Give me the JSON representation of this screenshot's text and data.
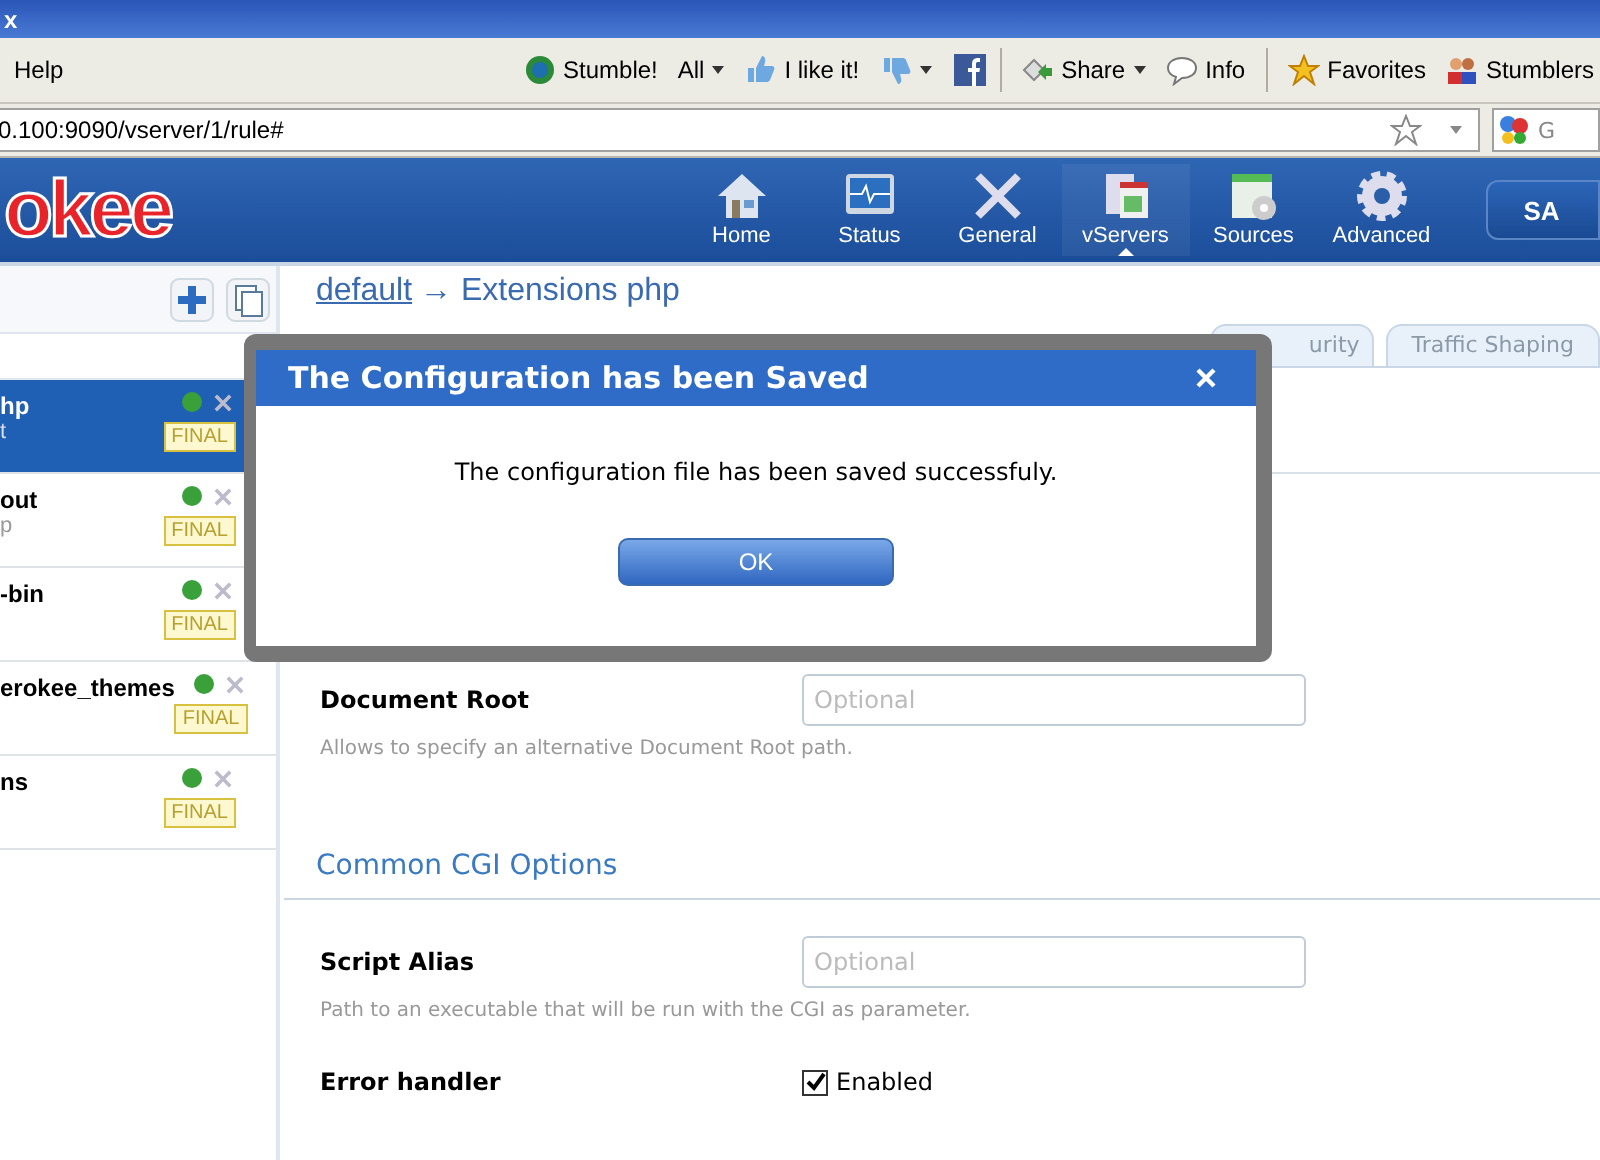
{
  "window": {
    "title": "x"
  },
  "menu": [
    {
      "label": "Help"
    }
  ],
  "toolbar": [
    {
      "label": "Stumble!",
      "dropdown": false
    },
    {
      "label": "All",
      "dropdown": true
    },
    {
      "label": "I like it!",
      "dropdown": false
    },
    {
      "dropdown": true
    },
    {
      "label": "Share",
      "dropdown": true
    },
    {
      "label": "Info",
      "dropdown": false
    },
    {
      "label": "Favorites",
      "dropdown": false
    },
    {
      "label": "Stumblers",
      "dropdown": false
    }
  ],
  "address": {
    "url": "0.100:9090/vserver/1/rule#",
    "search": "G"
  },
  "header": {
    "logo": "okee",
    "save": "SA"
  },
  "nav": [
    {
      "label": "Home",
      "selected": false
    },
    {
      "label": "Status",
      "selected": false
    },
    {
      "label": "General",
      "selected": false
    },
    {
      "label": "vServers",
      "selected": true
    },
    {
      "label": "Sources",
      "selected": false
    },
    {
      "label": "Advanced",
      "selected": false
    }
  ],
  "sidebar": {
    "items": [
      {
        "name": "hp",
        "sub": "t",
        "selected": true,
        "badge": "FINAL"
      },
      {
        "name": "out",
        "sub": "p",
        "selected": false,
        "badge": "FINAL"
      },
      {
        "name": "-bin",
        "selected": false,
        "badge": "FINAL"
      },
      {
        "name": "erokee_themes",
        "selected": false,
        "badge": "FINAL"
      },
      {
        "name": "ns",
        "selected": false,
        "badge": "FINAL"
      }
    ]
  },
  "breadcrumb": {
    "link": "default",
    "rest": "→ Extensions php"
  },
  "tabs": [
    {
      "label": "urity",
      "selected": false
    },
    {
      "label": "Traffic Shaping",
      "selected": false
    }
  ],
  "fields": [
    {
      "label": "Document Root",
      "placeholder": "Optional",
      "help": "Allows to specify an alternative Document Root path."
    }
  ],
  "section": {
    "title": "Common CGI Options",
    "fields": [
      {
        "label": "Script Alias",
        "placeholder": "Optional",
        "help": "Path to an executable that will be run with the CGI as parameter."
      }
    ]
  },
  "error_handler": {
    "label": "Error handler",
    "checked": true,
    "text": "Enabled"
  },
  "dialog": {
    "title": "The Configuration has been Saved",
    "message": "The configuration file has been saved successfuly.",
    "button": "OK"
  }
}
